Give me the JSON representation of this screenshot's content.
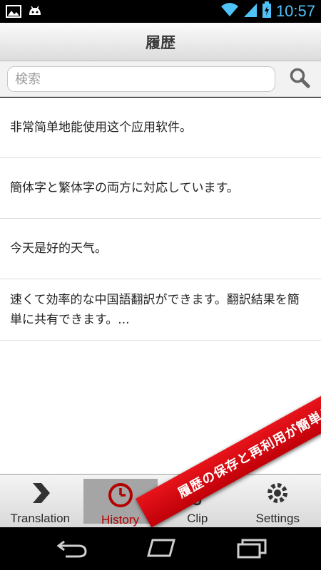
{
  "status_bar": {
    "time": "10:57"
  },
  "header": {
    "title": "履歴"
  },
  "search": {
    "placeholder": "検索",
    "value": ""
  },
  "history": {
    "items": [
      {
        "text": "非常简单地能使用这个应用软件。"
      },
      {
        "text": "簡体字と繁体字の両方に対応しています。"
      },
      {
        "text": "今天是好的天气。"
      },
      {
        "text": "速くて効率的な中国語翻訳ができます。翻訳結果を簡単に共有できます。..."
      }
    ]
  },
  "tabs": [
    {
      "label": "Translation",
      "icon": "chevron-right-icon",
      "active": false
    },
    {
      "label": "History",
      "icon": "clock-icon",
      "active": true
    },
    {
      "label": "Clip",
      "icon": "paperclip-icon",
      "active": false
    },
    {
      "label": "Settings",
      "icon": "gear-icon",
      "active": false
    }
  ],
  "promo": {
    "text": "履歴の保存と再利用が簡単に"
  },
  "colors": {
    "accent": "#b30000",
    "status_time": "#4fc3f7",
    "ribbon": "#d9101a"
  }
}
